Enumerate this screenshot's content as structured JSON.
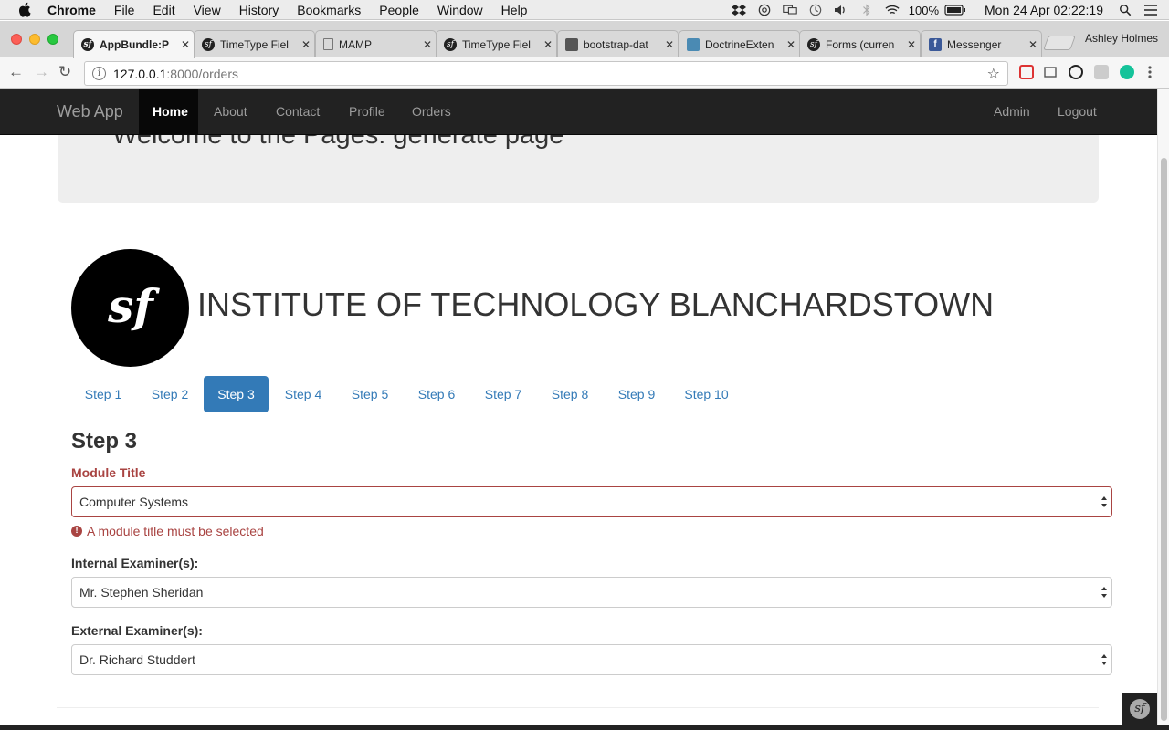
{
  "macos_menubar": {
    "app": "Chrome",
    "items": [
      "File",
      "Edit",
      "View",
      "History",
      "Bookmarks",
      "People",
      "Window",
      "Help"
    ],
    "battery": "100%",
    "clock": "Mon 24 Apr  02:22:19"
  },
  "browser": {
    "profile_name": "Ashley Holmes",
    "tabs": [
      {
        "label": "AppBundle:P",
        "icon": "symfony-icon",
        "active": true
      },
      {
        "label": "TimeType Fiel",
        "icon": "symfony-icon"
      },
      {
        "label": "MAMP",
        "icon": "document-icon"
      },
      {
        "label": "TimeType Fiel",
        "icon": "symfony-icon"
      },
      {
        "label": "bootstrap-dat",
        "icon": "bootstrap-icon"
      },
      {
        "label": "DoctrineExten",
        "icon": "doctrine-icon"
      },
      {
        "label": "Forms (curren",
        "icon": "symfony-icon"
      },
      {
        "label": "Messenger",
        "icon": "facebook-icon"
      }
    ],
    "url_host": "127.0.0.1",
    "url_path": ":8000/orders"
  },
  "navbar": {
    "brand": "Web App",
    "left_items": [
      "Home",
      "About",
      "Contact",
      "Profile",
      "Orders"
    ],
    "active": "Home",
    "right_items": [
      "Admin",
      "Logout"
    ]
  },
  "jumbotron": {
    "heading": "Welcome to the Pages: generate page"
  },
  "institute": {
    "name": "INSTITUTE OF TECHNOLOGY BLANCHARDSTOWN",
    "logo_glyph": "sf"
  },
  "steps": {
    "items": [
      "Step 1",
      "Step 2",
      "Step 3",
      "Step 4",
      "Step 5",
      "Step 6",
      "Step 7",
      "Step 8",
      "Step 9",
      "Step 10"
    ],
    "active": "Step 3"
  },
  "form": {
    "heading": "Step 3",
    "module_title": {
      "label": "Module Title",
      "value": "Computer Systems",
      "error": "A module title must be selected"
    },
    "internal_examiner": {
      "label": "Internal Examiner(s):",
      "value": "Mr. Stephen Sheridan"
    },
    "external_examiner": {
      "label": "External Examiner(s):",
      "value": "Dr. Richard Studdert"
    }
  },
  "colors": {
    "navbar_bg": "#222222",
    "link": "#337ab7",
    "error": "#a94442",
    "jumbotron_bg": "#eeeeee"
  }
}
